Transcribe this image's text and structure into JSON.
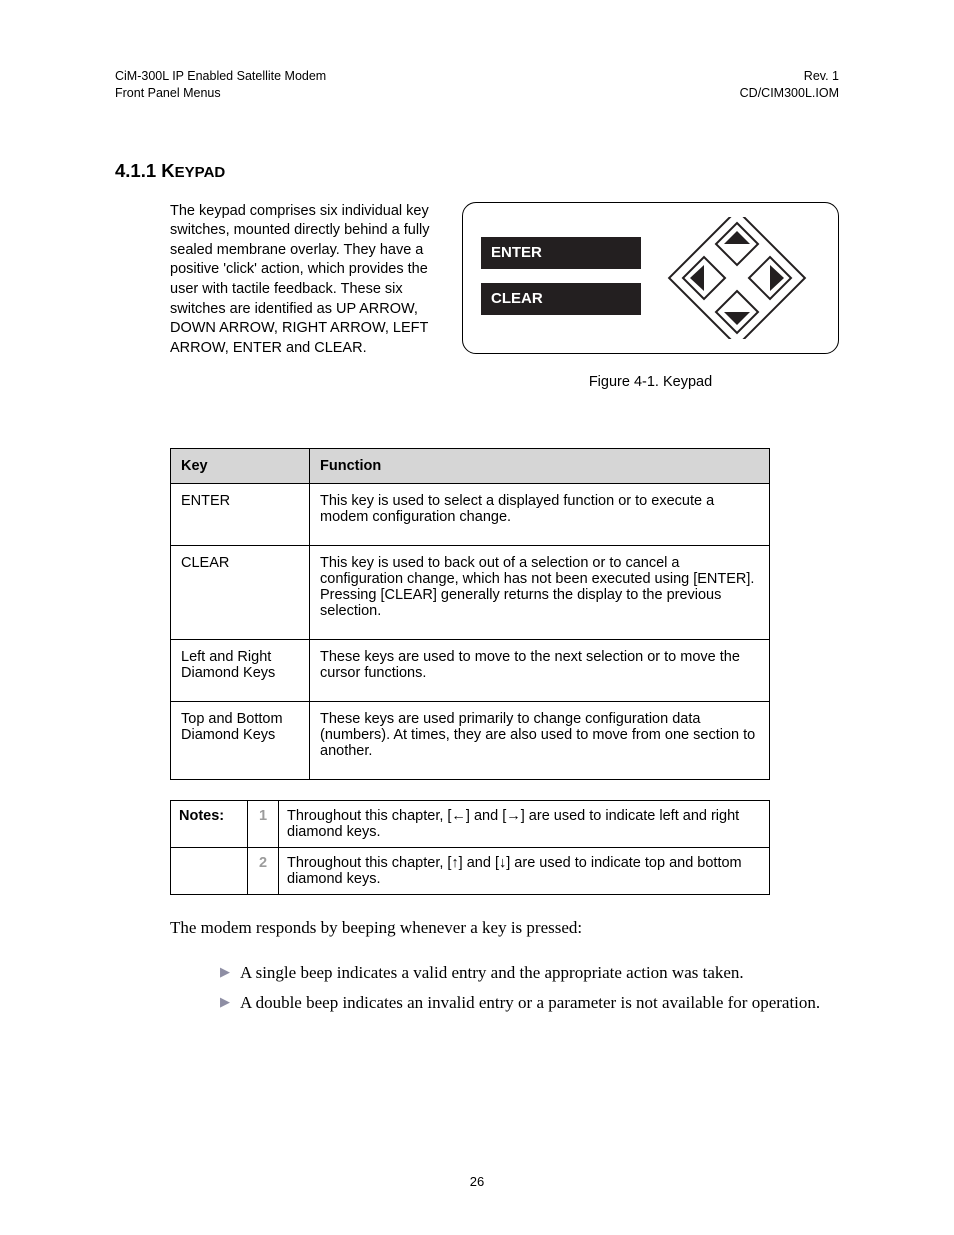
{
  "header": {
    "left_line1": "CiM-300L IP Enabled Satellite Modem",
    "left_line2": "Front Panel Menus",
    "right_line1": "Rev. 1",
    "right_line2": "CD/CIM300L.IOM"
  },
  "section": {
    "number": "4.1.1",
    "title_caps": "K",
    "title_rest": "EYPAD"
  },
  "intro_para": "The keypad comprises six individual key switches, mounted directly behind a fully sealed membrane overlay. They have a positive 'click' action, which provides the user with tactile feedback. These six switches are identified as UP ARROW, DOWN ARROW, RIGHT ARROW, LEFT ARROW, ENTER and CLEAR.",
  "figure": {
    "enter_label": "ENTER",
    "clear_label": "CLEAR",
    "caption": "Figure 4-1.  Keypad"
  },
  "key_table": {
    "head_key": "Key",
    "head_func": "Function",
    "rows": [
      {
        "key": "ENTER",
        "func": "This key is used to select a displayed function or to execute a modem configuration change."
      },
      {
        "key": "CLEAR",
        "func": "This key is used to back out of a selection or to cancel a configuration change, which has not been executed using [ENTER]. Pressing [CLEAR] generally returns the display to the previous selection."
      },
      {
        "key": "Left and Right Diamond Keys",
        "func": "These keys are used to move to the next selection or to move the cursor functions."
      },
      {
        "key": "Top and Bottom Diamond Keys",
        "func": "These keys are used primarily to change configuration data (numbers). At times, they are also used to move from one section to another."
      }
    ]
  },
  "notes": {
    "label": "Notes:",
    "items": [
      {
        "num": "1",
        "text": "Throughout this chapter, [←] and [→] are used to indicate left and right diamond keys."
      },
      {
        "num": "2",
        "text": "Throughout this chapter, [↑] and [↓] are used to indicate top and bottom diamond keys."
      }
    ]
  },
  "body_para": "The modem responds by beeping whenever a key is pressed:",
  "bullets": [
    "A single beep indicates a valid entry and the appropriate action was taken.",
    "A double beep indicates an invalid entry or a parameter is not available for operation."
  ],
  "page_number": "26"
}
